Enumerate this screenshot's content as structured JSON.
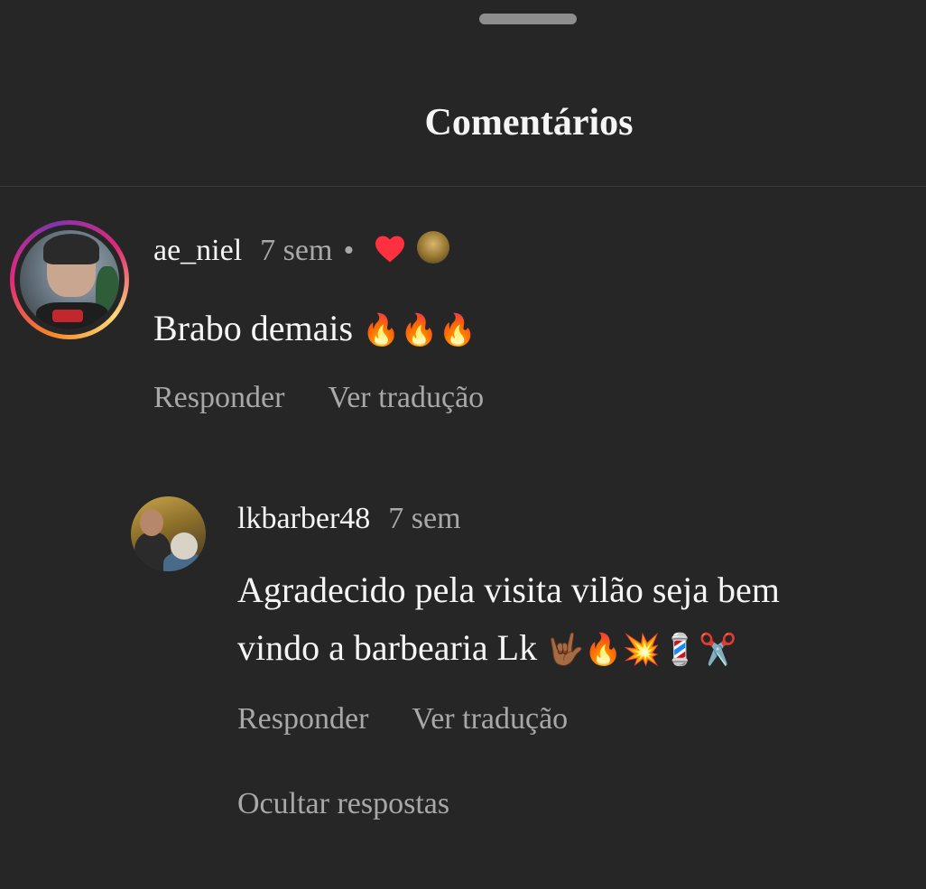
{
  "sheet": {
    "title": "Comentários"
  },
  "comments": [
    {
      "username": "ae_niel",
      "time": "7 sem",
      "separator": "•",
      "text": "Brabo demais",
      "emojis": "🔥🔥🔥",
      "actions": {
        "reply": "Responder",
        "translate": "Ver tradução"
      },
      "liked_by_author": true
    }
  ],
  "replies": [
    {
      "username": "lkbarber48",
      "time": "7 sem",
      "text_line1": "Agradecido pela visita vilão seja bem",
      "text_line2": "vindo a barbearia Lk",
      "emojis": "🤟🏾🔥💥💈✂️",
      "actions": {
        "reply": "Responder",
        "translate": "Ver tradução"
      }
    }
  ],
  "hide_replies_label": "Ocultar respostas",
  "colors": {
    "background": "#262626",
    "primary_text": "#f5f5f5",
    "secondary_text": "#a8a8a8",
    "heart": "#ff3040"
  },
  "icons": {
    "heart": "heart-icon",
    "handle": "drag-handle"
  }
}
